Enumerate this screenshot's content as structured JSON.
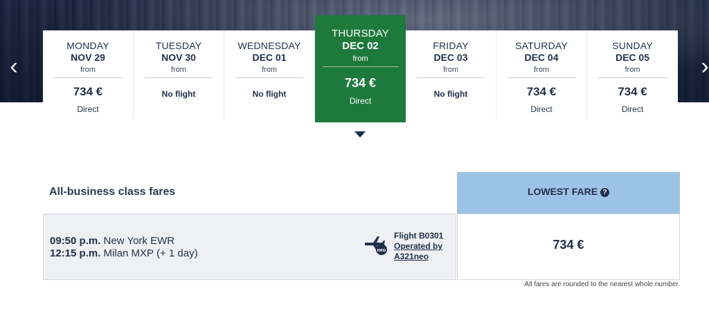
{
  "nav": {
    "prev_arrow": "‹",
    "next_arrow": "›"
  },
  "days": [
    {
      "weekday": "MONDAY",
      "date": "NOV 29",
      "from": "from",
      "price": "734 €",
      "status": "Direct",
      "has_flight": true
    },
    {
      "weekday": "TUESDAY",
      "date": "NOV 30",
      "from": "from",
      "price": "",
      "status": "No flight",
      "has_flight": false
    },
    {
      "weekday": "WEDNESDAY",
      "date": "DEC 01",
      "from": "from",
      "price": "",
      "status": "No flight",
      "has_flight": false
    },
    {
      "weekday": "THURSDAY",
      "date": "DEC 02",
      "from": "from",
      "price": "734 €",
      "status": "Direct",
      "has_flight": true,
      "selected": true
    },
    {
      "weekday": "FRIDAY",
      "date": "DEC 03",
      "from": "from",
      "price": "",
      "status": "No flight",
      "has_flight": false
    },
    {
      "weekday": "SATURDAY",
      "date": "DEC 04",
      "from": "from",
      "price": "734 €",
      "status": "Direct",
      "has_flight": true
    },
    {
      "weekday": "SUNDAY",
      "date": "DEC 05",
      "from": "from",
      "price": "734 €",
      "status": "Direct",
      "has_flight": true
    }
  ],
  "fares": {
    "title": "All-business class fares",
    "lowest_label": "LOWEST FARE",
    "help_icon": "?",
    "flight": {
      "depart_time": "09:50 p.m.",
      "depart_place": "New York EWR",
      "arrive_time": "12:15 p.m.",
      "arrive_place": "Milan MXP (+ 1 day)",
      "number": "Flight B0301",
      "operated_by": "Operated by",
      "aircraft": "A321neo",
      "plane_badge": "neo",
      "price": "734 €"
    },
    "note": "All fares are rounded to the nearest whole number."
  },
  "colors": {
    "selected_day": "#1e7a3c",
    "lowest_header": "#9dc3e6",
    "text": "#1f2f4a"
  }
}
